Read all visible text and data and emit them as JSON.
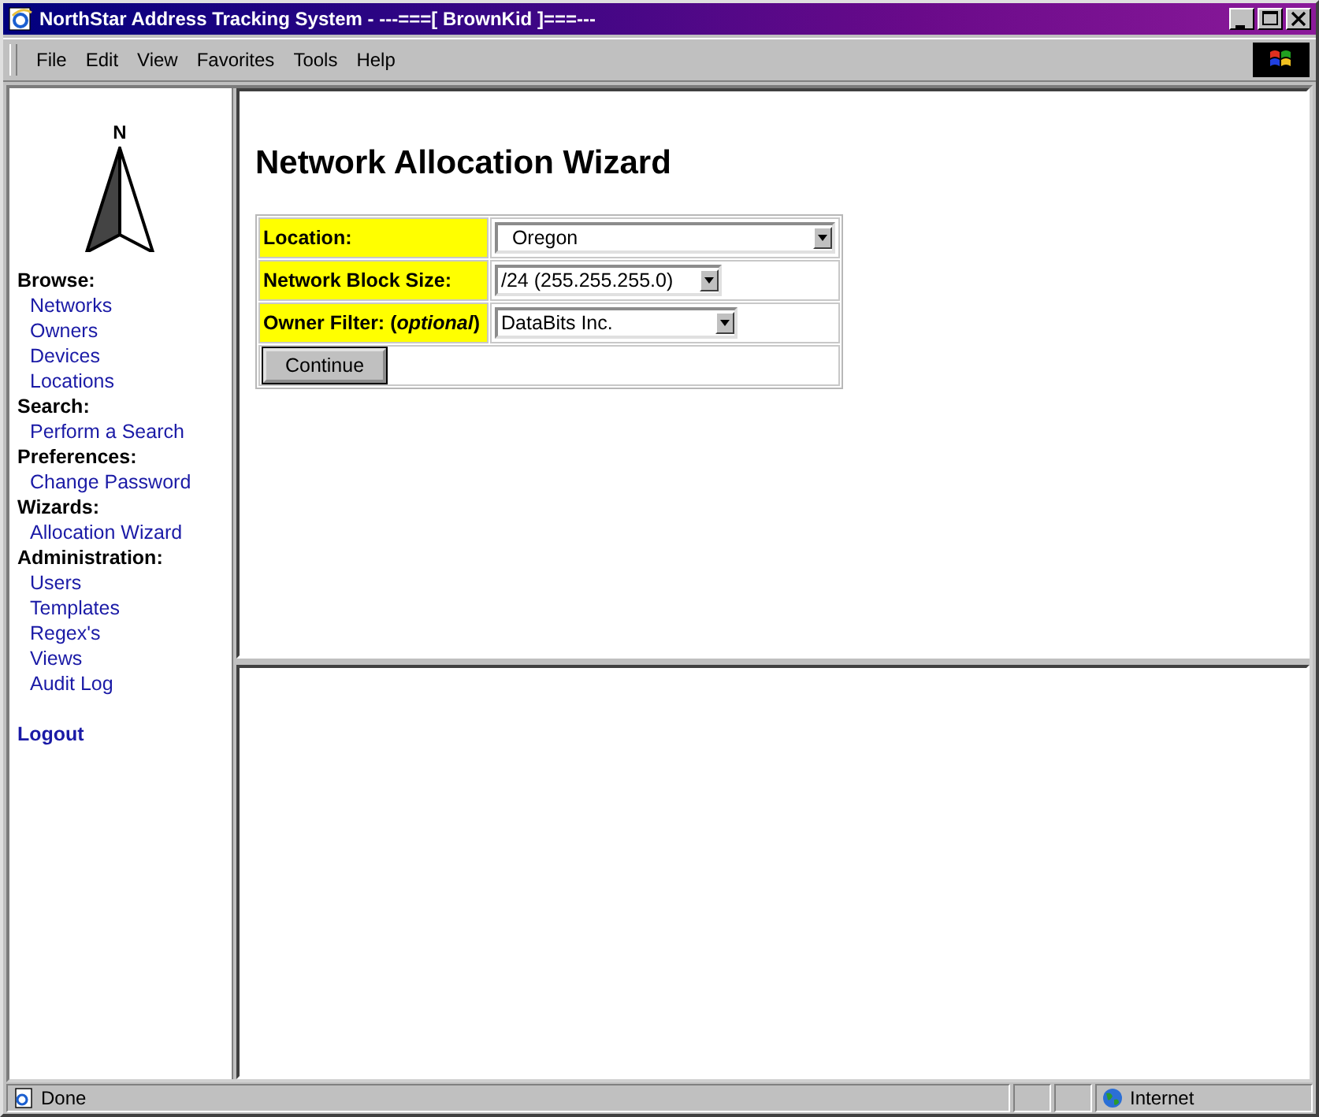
{
  "window": {
    "title": "NorthStar Address Tracking System - ---===[ BrownKid ]===---"
  },
  "menu": [
    "File",
    "Edit",
    "View",
    "Favorites",
    "Tools",
    "Help"
  ],
  "sidebar": {
    "logo": "N",
    "sections": [
      {
        "heading": "Browse:",
        "links": [
          "Networks",
          "Owners",
          "Devices",
          "Locations"
        ]
      },
      {
        "heading": "Search:",
        "links": [
          "Perform a Search"
        ]
      },
      {
        "heading": "Preferences:",
        "links": [
          "Change Password"
        ]
      },
      {
        "heading": "Wizards:",
        "links": [
          "Allocation Wizard"
        ]
      },
      {
        "heading": "Administration:",
        "links": [
          "Users",
          "Templates",
          "Regex's",
          "Views",
          "Audit Log"
        ]
      }
    ],
    "logout": "Logout"
  },
  "wizard": {
    "title": "Network Allocation Wizard",
    "fields": [
      {
        "label": "Location:",
        "value": "  Oregon"
      },
      {
        "label": "Network Block Size:",
        "value": "/24 (255.255.255.0)"
      },
      {
        "label": "Owner Filter: (*optional*)",
        "value": "DataBits Inc."
      }
    ],
    "button": "Continue"
  },
  "status_bar": {
    "text": "Done",
    "zone": "Internet"
  }
}
